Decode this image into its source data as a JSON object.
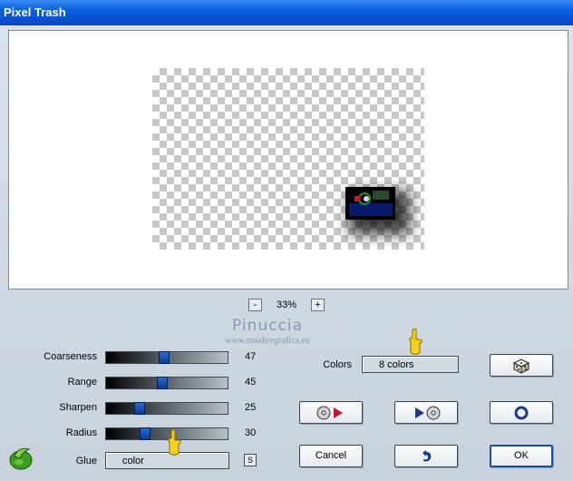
{
  "window": {
    "title": "Pixel Trash"
  },
  "zoom": {
    "minus": "-",
    "value": "33%",
    "plus": "+"
  },
  "watermark": {
    "name": "Pinuccia",
    "url": "www.maidiregrafica.eu"
  },
  "sliders": [
    {
      "label": "Coarseness",
      "value": "47",
      "fraction": 0.47
    },
    {
      "label": "Range",
      "value": "45",
      "fraction": 0.45
    },
    {
      "label": "Sharpen",
      "value": "25",
      "fraction": 0.25
    },
    {
      "label": "Radius",
      "value": "30",
      "fraction": 0.3
    }
  ],
  "glue": {
    "label": "Glue",
    "value": "color",
    "button": "S"
  },
  "colors": {
    "label": "Colors",
    "value": "8 colors"
  },
  "buttons": {
    "cancel": "Cancel",
    "ok": "OK"
  },
  "icons": {
    "randomize": "dice-icon",
    "play_forward": "disc-play-icon",
    "play_back": "play-disc-icon",
    "reset": "ring-icon",
    "undo": "undo-arrow-icon",
    "logo": "leaf-logo-icon",
    "pointer": "pointing-finger-icon"
  },
  "colors_palette": {
    "title_bar": "#0a5fe0",
    "accent": "#1a4fa0"
  }
}
